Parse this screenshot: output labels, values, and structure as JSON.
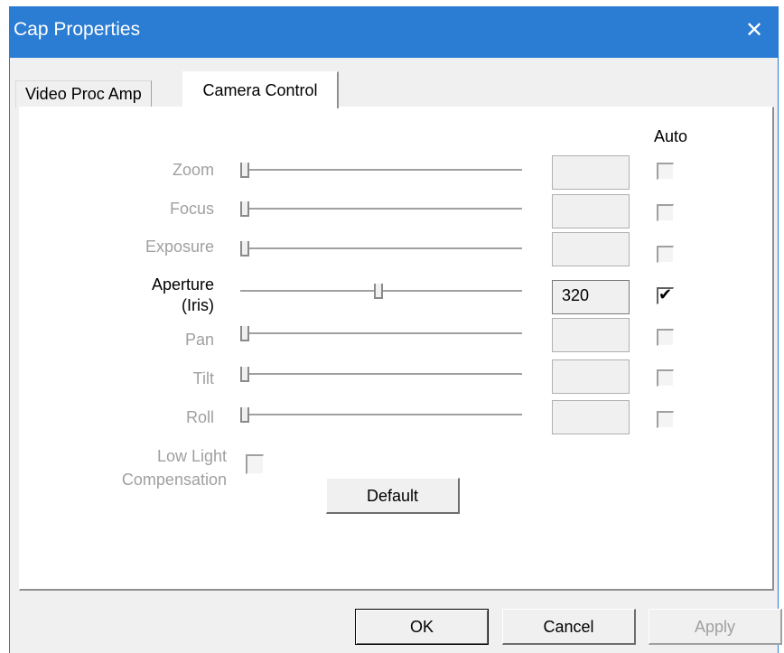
{
  "window": {
    "title": "Cap Properties",
    "close_glyph": "✕",
    "accent": "#2b7cd3"
  },
  "tabs": [
    {
      "label": "Video Proc Amp",
      "active": false
    },
    {
      "label": "Camera Control",
      "active": true
    }
  ],
  "auto_header": "Auto",
  "controls": [
    {
      "label": "Zoom",
      "enabled": false,
      "slider": 0.0,
      "value": "",
      "auto": false
    },
    {
      "label": "Focus",
      "enabled": false,
      "slider": 0.0,
      "value": "",
      "auto": false
    },
    {
      "label": "Exposure",
      "enabled": false,
      "slider": 0.0,
      "value": "",
      "auto": false
    },
    {
      "label_line1": "Aperture",
      "label_line2": "(Iris)",
      "enabled": true,
      "slider": 0.49,
      "value": "320",
      "auto": true,
      "check_glyph": "✔"
    },
    {
      "label": "Pan",
      "enabled": false,
      "slider": 0.0,
      "value": "",
      "auto": false
    },
    {
      "label": "Tilt",
      "enabled": false,
      "slider": 0.0,
      "value": "",
      "auto": false
    },
    {
      "label": "Roll",
      "enabled": false,
      "slider": 0.0,
      "value": "",
      "auto": false
    }
  ],
  "low_light": {
    "line1": "Low Light",
    "line2": "Compensation",
    "enabled": false,
    "checked": false
  },
  "buttons": {
    "default": "Default",
    "ok": "OK",
    "cancel": "Cancel",
    "apply": "Apply"
  }
}
